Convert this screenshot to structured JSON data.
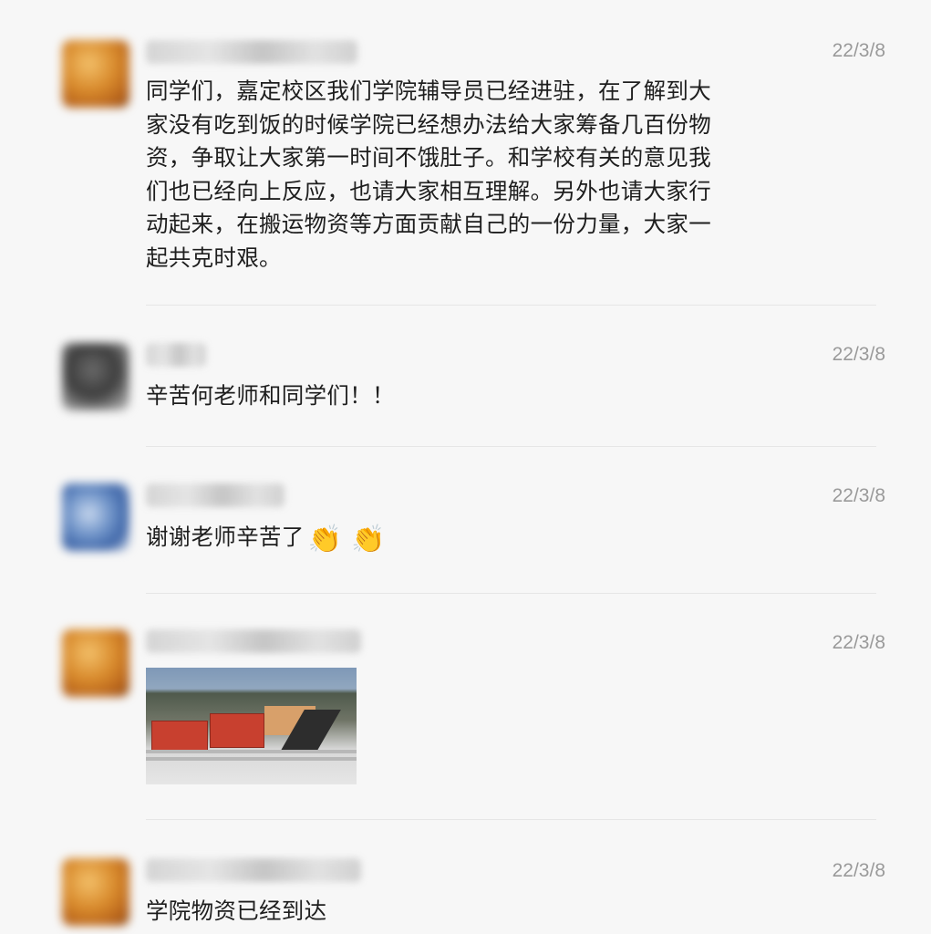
{
  "comments": [
    {
      "avatar": "blurred-orange-avatar",
      "time": "22/3/8",
      "text_lines": [
        "同学们，嘉定校区我们学院辅导员已经进驻，在了解到大",
        "家没有吃到饭的时候学院已经想办法给大家筹备几百份物",
        "资，争取让大家第一时间不饿肚子。和学校有关的意见我",
        "们也已经向上反应，也请大家相互理解。另外也请大家行",
        "动起来，在搬运物资等方面贡献自己的一份力量，大家一",
        "起共克时艰。"
      ]
    },
    {
      "avatar": "blurred-gray-avatar",
      "time": "22/3/8",
      "text": "辛苦何老师和同学们！！"
    },
    {
      "avatar": "blurred-blue-avatar",
      "time": "22/3/8",
      "text": "谢谢老师辛苦了",
      "emoji": [
        "clapping-hands-icon",
        "clapping-hands-icon"
      ],
      "emoji_glyph": "👏"
    },
    {
      "avatar": "blurred-orange-avatar",
      "time": "22/3/8",
      "image": "photo-supplies-delivery"
    },
    {
      "avatar": "blurred-orange-avatar",
      "time": "22/3/8",
      "text": "学院物资已经到达"
    }
  ],
  "colors": {
    "background": "#f7f7f7",
    "time": "#9a9a9a",
    "text": "#1e1e1e",
    "divider": "#e6e6e6"
  }
}
